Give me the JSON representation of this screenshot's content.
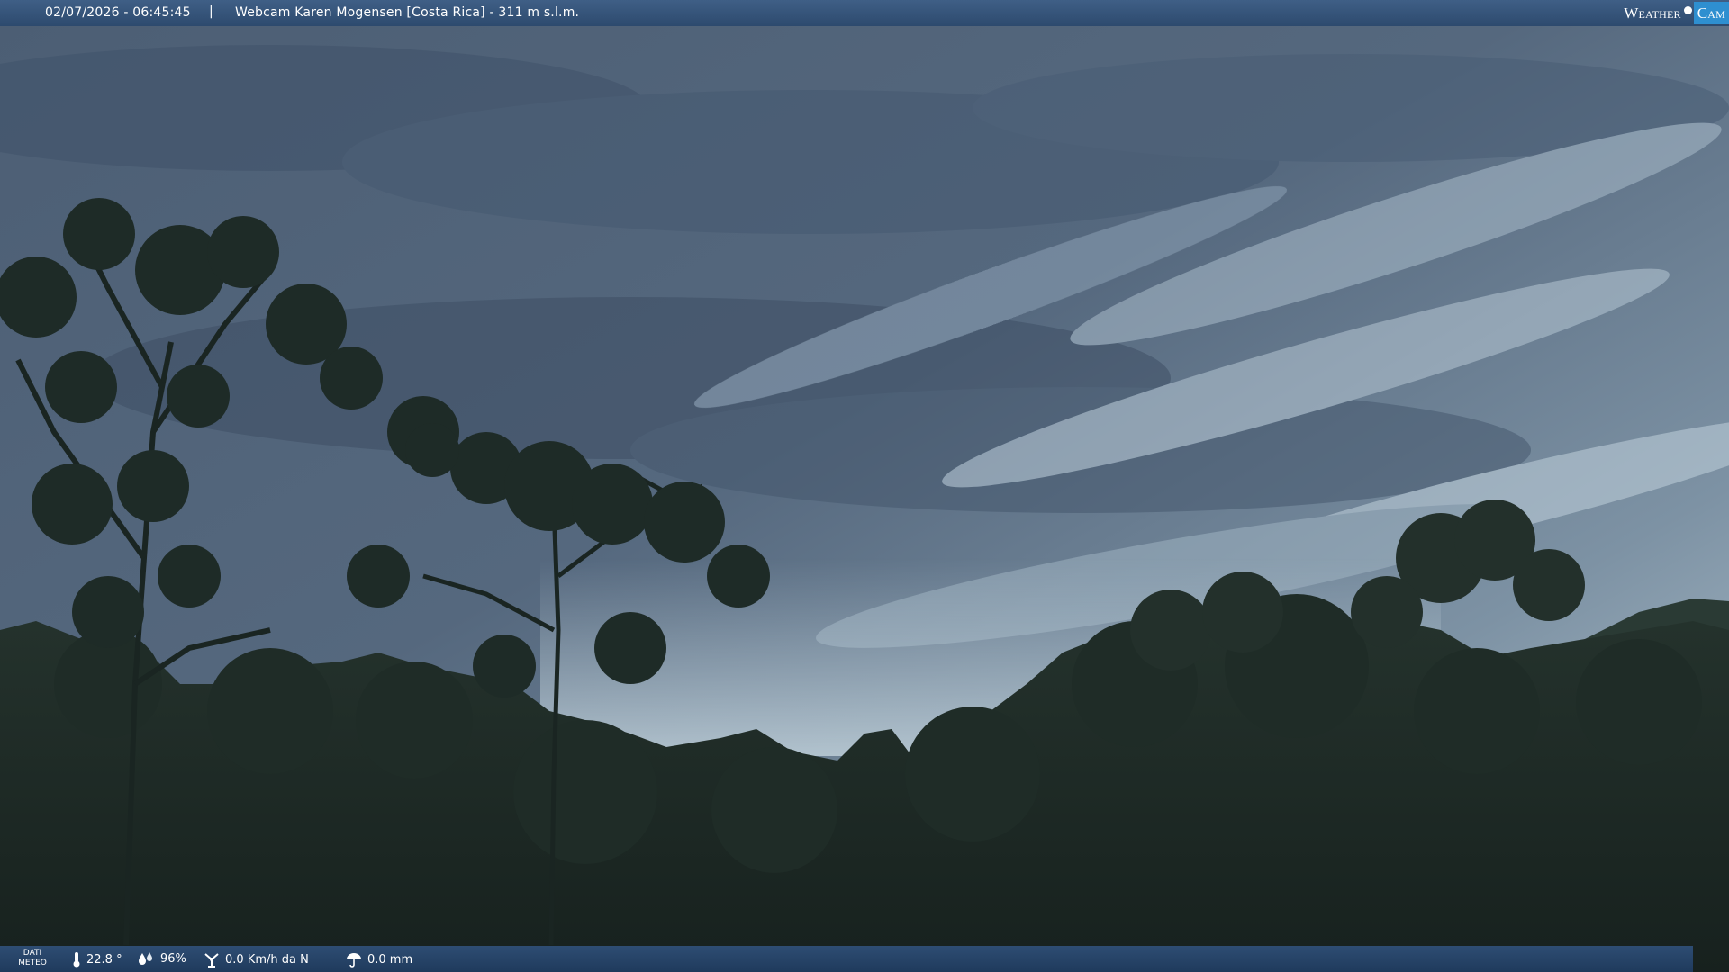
{
  "header": {
    "datetime": "02/07/2026 - 06:45:45",
    "separator": "|",
    "title": "Webcam Karen Mogensen [Costa Rica]  - 311 m s.l.m."
  },
  "logo": {
    "weather_text": "Weather",
    "cam_text": "Cam",
    "accent_color": "#2e8fd0"
  },
  "weather_bar": {
    "label_line1": "DATI",
    "label_line2": "METEO",
    "temperature": "22.8 °",
    "humidity": "96%",
    "wind": "0.0 Km/h da N",
    "rain": "0.0 mm",
    "icons": {
      "temperature": "thermometer-icon",
      "humidity": "humidity-drops-icon",
      "wind": "wind-vane-icon",
      "rain": "umbrella-icon"
    }
  },
  "colors": {
    "bar_top": "#3f5f86",
    "bar_bottom": "#1f3a5c",
    "sky_top": "#52657c",
    "sky_light": "#c9d7e0",
    "forest": "#1d2a26"
  }
}
